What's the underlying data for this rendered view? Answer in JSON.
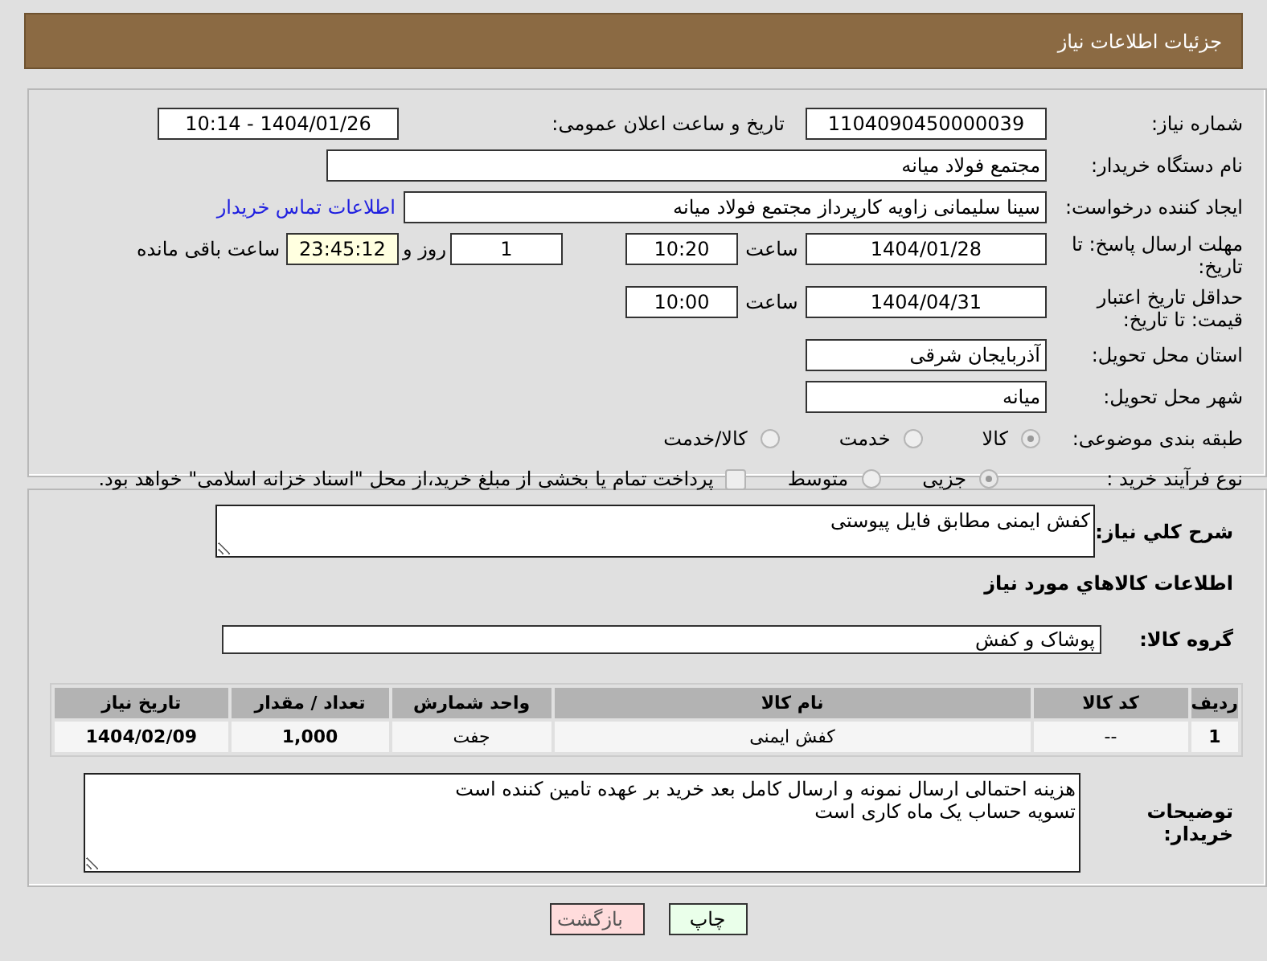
{
  "header": {
    "title": "جزئیات اطلاعات نیاز"
  },
  "need_number": {
    "label": "شماره نیاز:",
    "value": "1104090450000039"
  },
  "announce": {
    "label": "تاریخ و ساعت اعلان عمومی:",
    "value": "1404/01/26 - 10:14"
  },
  "buyer_org": {
    "label": "نام دستگاه خریدار:",
    "value": "مجتمع فولاد میانه"
  },
  "creator": {
    "label": "ایجاد کننده درخواست:",
    "value": "سینا سلیمانی زاویه کارپرداز مجتمع فولاد میانه",
    "link": "اطلاعات تماس خریدار"
  },
  "reply_deadline": {
    "label": "مهلت ارسال پاسخ: تا تاریخ:",
    "date": "1404/01/28",
    "time_label": "ساعت",
    "time": "10:20",
    "days": "1",
    "days_label": "روز و",
    "remaining": "23:45:12",
    "remaining_label": "ساعت باقی مانده"
  },
  "price_validity": {
    "label": "حداقل تاریخ اعتبار قیمت: تا تاریخ:",
    "date": "1404/04/31",
    "time_label": "ساعت",
    "time": "10:00"
  },
  "province": {
    "label": "استان محل تحویل:",
    "value": "آذربایجان شرقی"
  },
  "city": {
    "label": "شهر محل تحویل:",
    "value": "میانه"
  },
  "category": {
    "label": "طبقه بندی موضوعی:",
    "options": [
      {
        "label": "کالا",
        "selected": true
      },
      {
        "label": "خدمت",
        "selected": false
      },
      {
        "label": "کالا/خدمت",
        "selected": false
      }
    ]
  },
  "purchase_process": {
    "label": "نوع فرآیند خرید :",
    "options": [
      {
        "label": "جزیی",
        "selected": true
      },
      {
        "label": "متوسط",
        "selected": false
      }
    ],
    "payment": {
      "label": "پرداخت تمام یا بخشی از مبلغ خرید،از محل \"اسناد خزانه اسلامی\" خواهد بود.",
      "checked": false
    }
  },
  "description": {
    "label": "شرح کلي نياز:",
    "value": "کفش ایمنی مطابق فایل پیوستی"
  },
  "goods_heading": "اطلاعات کالاهاي مورد نياز",
  "goods_group": {
    "label": "گروه کالا:",
    "value": "پوشاک و کفش"
  },
  "table": {
    "columns": [
      "ردیف",
      "کد کالا",
      "نام کالا",
      "واحد شمارش",
      "تعداد / مقدار",
      "تاریخ نیاز"
    ],
    "rows": [
      [
        "1",
        "--",
        "کفش ایمنی",
        "جفت",
        "1,000",
        "1404/02/09"
      ]
    ]
  },
  "buyer_notes": {
    "label": "توضیحات خریدار:",
    "lines": [
      "هزینه احتمالی ارسال نمونه و ارسال کامل بعد خرید بر عهده تامین کننده است",
      "تسویه حساب یک ماه کاری است"
    ]
  },
  "buttons": [
    {
      "label": "چاپ",
      "kind": "print"
    },
    {
      "label": "بازگشت",
      "kind": "back"
    }
  ]
}
